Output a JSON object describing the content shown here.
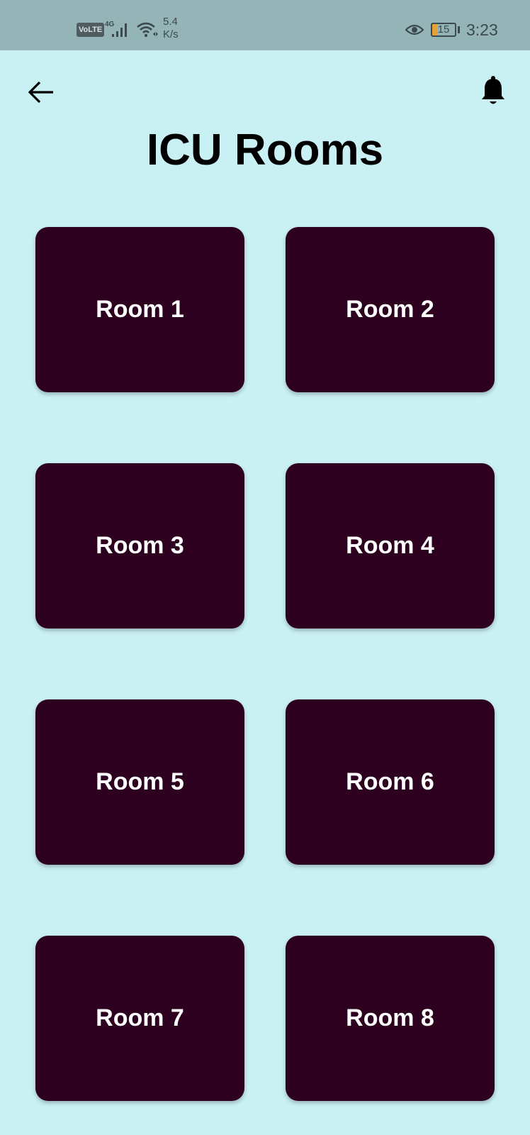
{
  "status_bar": {
    "volte": "VoLTE",
    "network": "4G",
    "speed_value": "5.4",
    "speed_unit": "K/s",
    "battery": "15",
    "time": "3:23",
    "icons": [
      "signal-icon",
      "wifi-icon",
      "eye-icon",
      "battery-icon"
    ]
  },
  "header": {
    "back_icon": "arrow-left-icon",
    "notification_icon": "bell-icon",
    "title": "ICU Rooms"
  },
  "rooms": [
    {
      "label": "Room 1"
    },
    {
      "label": "Room 2"
    },
    {
      "label": "Room 3"
    },
    {
      "label": "Room 4"
    },
    {
      "label": "Room 5"
    },
    {
      "label": "Room 6"
    },
    {
      "label": "Room 7"
    },
    {
      "label": "Room 8"
    }
  ],
  "colors": {
    "background": "#c9f0f3",
    "status_bar": "#95b4b8",
    "card": "#2c001e",
    "card_text": "#ffffff",
    "title": "#000000"
  }
}
